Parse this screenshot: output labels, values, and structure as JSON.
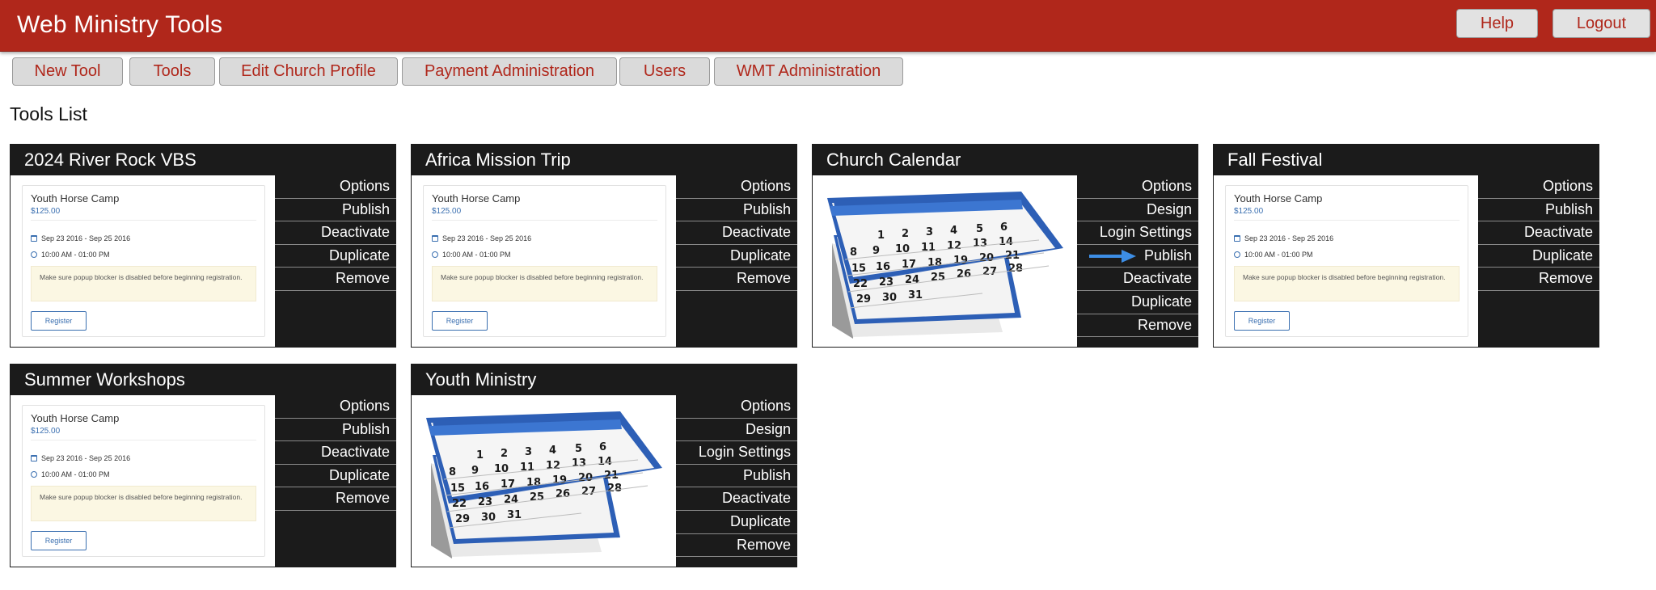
{
  "app": {
    "title": "Web Ministry Tools"
  },
  "header": {
    "help_label": "Help",
    "logout_label": "Logout"
  },
  "nav": {
    "items": [
      {
        "label": "New Tool"
      },
      {
        "label": "Tools"
      },
      {
        "label": "Edit Church Profile"
      },
      {
        "label": "Payment Administration"
      },
      {
        "label": "Users"
      },
      {
        "label": "WMT Administration"
      }
    ]
  },
  "page": {
    "title": "Tools List"
  },
  "card_sample": {
    "title": "Youth Horse Camp",
    "price": "$125.00",
    "dates": "Sep 23 2016 - Sep 25 2016",
    "time": "10:00 AM - 01:00 PM",
    "note": "Make sure popup blocker is disabled before beginning registration.",
    "register_label": "Register"
  },
  "calendar_image": {
    "row1": [
      "1",
      "2",
      "3",
      "4",
      "5",
      "6"
    ],
    "row2": [
      "8",
      "9",
      "10",
      "11",
      "12",
      "13",
      "14"
    ],
    "row3": [
      "15",
      "16",
      "17",
      "18",
      "19",
      "20",
      "21"
    ],
    "row4": [
      "22",
      "23",
      "24",
      "25",
      "26",
      "27",
      "28"
    ],
    "row5": [
      "29",
      "30",
      "31"
    ]
  },
  "tools": [
    {
      "name": "2024 River Rock VBS",
      "preview": "card",
      "actions": [
        "Options",
        "Publish",
        "Deactivate",
        "Duplicate",
        "Remove"
      ]
    },
    {
      "name": "Africa Mission Trip",
      "preview": "card",
      "actions": [
        "Options",
        "Publish",
        "Deactivate",
        "Duplicate",
        "Remove"
      ]
    },
    {
      "name": "Church Calendar",
      "preview": "calendar",
      "actions": [
        "Options",
        "Design",
        "Login Settings",
        "Publish",
        "Deactivate",
        "Duplicate",
        "Remove"
      ]
    },
    {
      "name": "Fall Festival",
      "preview": "card",
      "actions": [
        "Options",
        "Publish",
        "Deactivate",
        "Duplicate",
        "Remove"
      ]
    },
    {
      "name": "Summer Workshops",
      "preview": "card",
      "actions": [
        "Options",
        "Publish",
        "Deactivate",
        "Duplicate",
        "Remove"
      ]
    },
    {
      "name": "Youth Ministry",
      "preview": "calendar",
      "actions": [
        "Options",
        "Design",
        "Login Settings",
        "Publish",
        "Deactivate",
        "Duplicate",
        "Remove"
      ]
    }
  ],
  "colors": {
    "brand_red": "#b0271b",
    "tile_dark": "#1b1b1b",
    "link_blue": "#3a6fb0",
    "arrow_blue": "#3d8ee6"
  }
}
